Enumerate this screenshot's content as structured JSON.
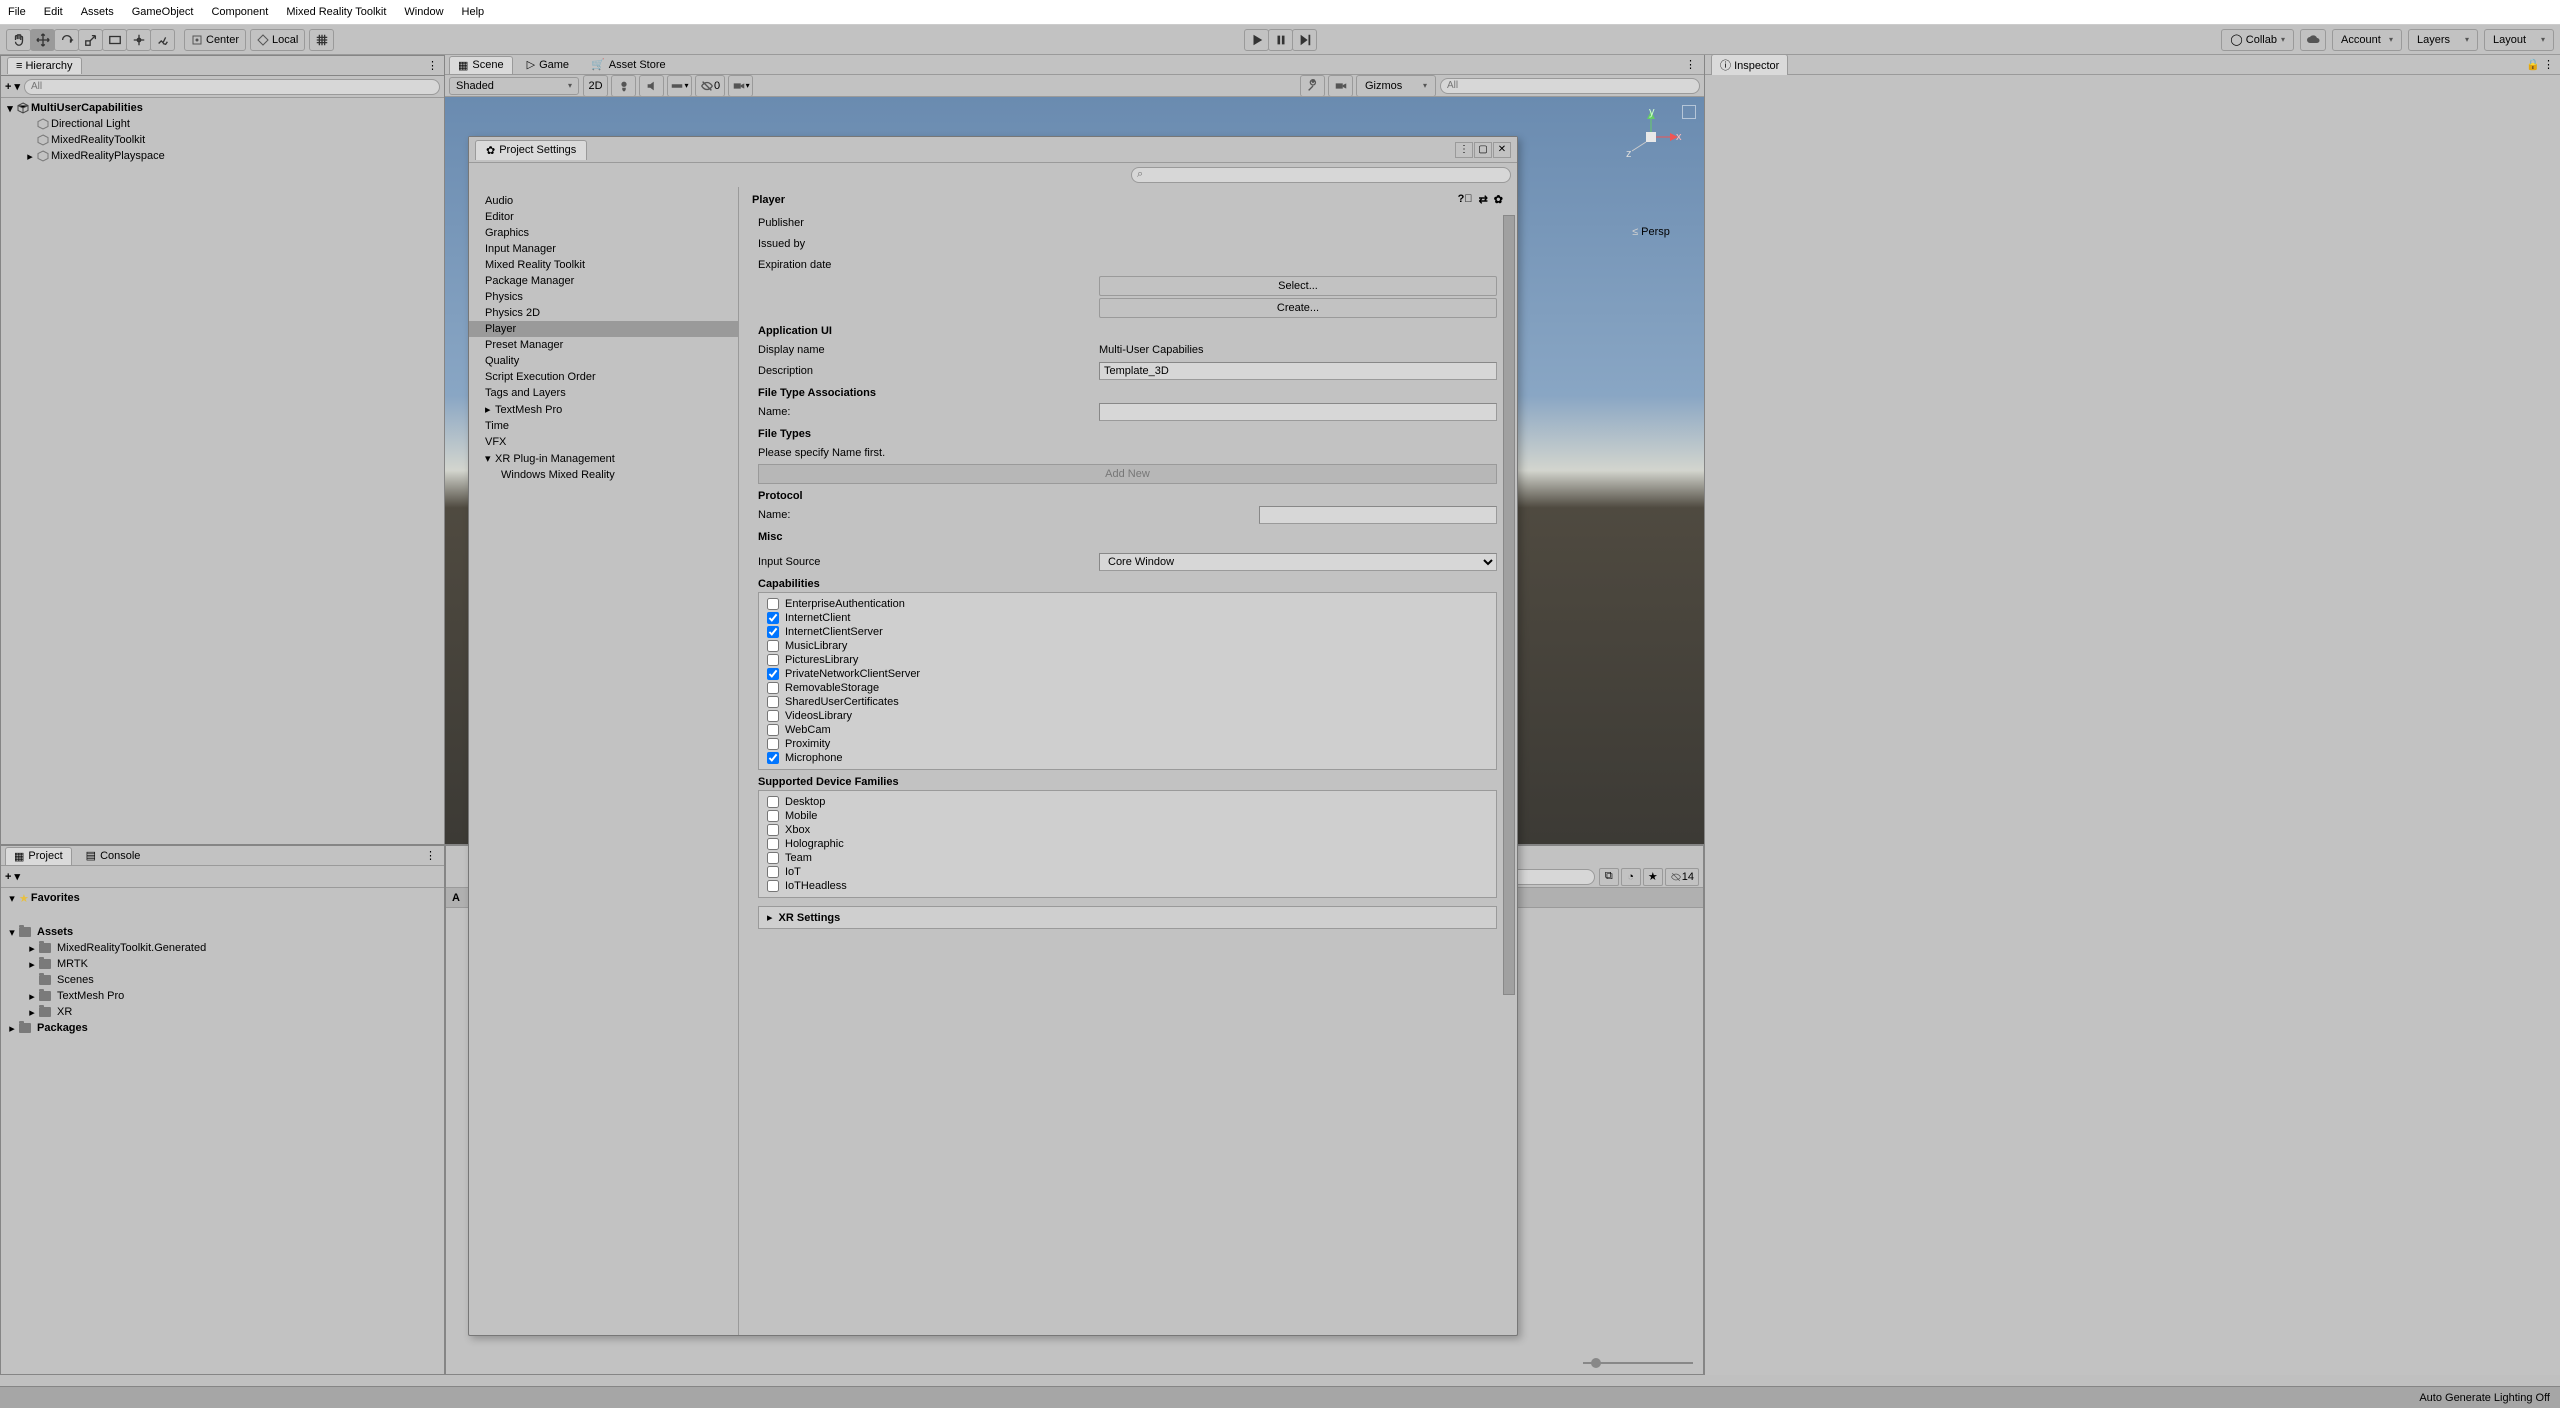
{
  "menu": [
    "File",
    "Edit",
    "Assets",
    "GameObject",
    "Component",
    "Mixed Reality Toolkit",
    "Window",
    "Help"
  ],
  "toolbar": {
    "pivot_center": "Center",
    "pivot_local": "Local",
    "collab": "Collab",
    "account": "Account",
    "layers": "Layers",
    "layout": "Layout"
  },
  "hierarchy": {
    "tab": "Hierarchy",
    "search_placeholder": "All",
    "root": "MultiUserCapabilities",
    "items": [
      "Directional Light",
      "MixedRealityToolkit",
      "MixedRealityPlayspace"
    ]
  },
  "scene": {
    "tabs": [
      "Scene",
      "Game",
      "Asset Store"
    ],
    "shaded": "Shaded",
    "mode": "2D",
    "gizmos": "Gizmos",
    "search_placeholder": "All",
    "persp": "Persp",
    "x": "x",
    "y": "y",
    "z": "z",
    "viscount": "0"
  },
  "project": {
    "tabs": [
      "Project",
      "Console"
    ],
    "favorites": "Favorites",
    "assets": "Assets",
    "assets_letter": "A",
    "packages": "Packages",
    "asset_folders": [
      "MixedRealityToolkit.Generated",
      "MRTK",
      "Scenes",
      "TextMesh Pro",
      "XR"
    ],
    "hidden_count": "14"
  },
  "inspector": {
    "tab": "Inspector"
  },
  "settings": {
    "title": "Project Settings",
    "sidebar": [
      "Audio",
      "Editor",
      "Graphics",
      "Input Manager",
      "Mixed Reality Toolkit",
      "Package Manager",
      "Physics",
      "Physics 2D",
      "Player",
      "Preset Manager",
      "Quality",
      "Script Execution Order",
      "Tags and Layers",
      "TextMesh Pro",
      "Time",
      "VFX",
      "XR Plug-in Management"
    ],
    "sidebar_child": "Windows Mixed Reality",
    "selected": "Player",
    "header": "Player",
    "publisher": "Publisher",
    "issued_by": "Issued by",
    "expiration": "Expiration date",
    "select_btn": "Select...",
    "create_btn": "Create...",
    "app_ui": "Application UI",
    "display_name_label": "Display name",
    "display_name_value": "Multi-User Capabilies",
    "description_label": "Description",
    "description_value": "Template_3D",
    "fta": "File Type Associations",
    "name_label": "Name:",
    "file_types": "File Types",
    "fta_hint": "Please specify Name first.",
    "add_new": "Add New",
    "protocol": "Protocol",
    "misc": "Misc",
    "input_source_label": "Input Source",
    "input_source_value": "Core Window",
    "capabilities_label": "Capabilities",
    "capabilities": [
      {
        "label": "EnterpriseAuthentication",
        "checked": false
      },
      {
        "label": "InternetClient",
        "checked": true
      },
      {
        "label": "InternetClientServer",
        "checked": true
      },
      {
        "label": "MusicLibrary",
        "checked": false
      },
      {
        "label": "PicturesLibrary",
        "checked": false
      },
      {
        "label": "PrivateNetworkClientServer",
        "checked": true
      },
      {
        "label": "RemovableStorage",
        "checked": false
      },
      {
        "label": "SharedUserCertificates",
        "checked": false
      },
      {
        "label": "VideosLibrary",
        "checked": false
      },
      {
        "label": "WebCam",
        "checked": false
      },
      {
        "label": "Proximity",
        "checked": false
      },
      {
        "label": "Microphone",
        "checked": true
      }
    ],
    "devices_label": "Supported Device Families",
    "devices": [
      {
        "label": "Desktop",
        "checked": false
      },
      {
        "label": "Mobile",
        "checked": false
      },
      {
        "label": "Xbox",
        "checked": false
      },
      {
        "label": "Holographic",
        "checked": false
      },
      {
        "label": "Team",
        "checked": false
      },
      {
        "label": "IoT",
        "checked": false
      },
      {
        "label": "IoTHeadless",
        "checked": false
      }
    ],
    "xr": "XR Settings"
  },
  "status": "Auto Generate Lighting Off"
}
